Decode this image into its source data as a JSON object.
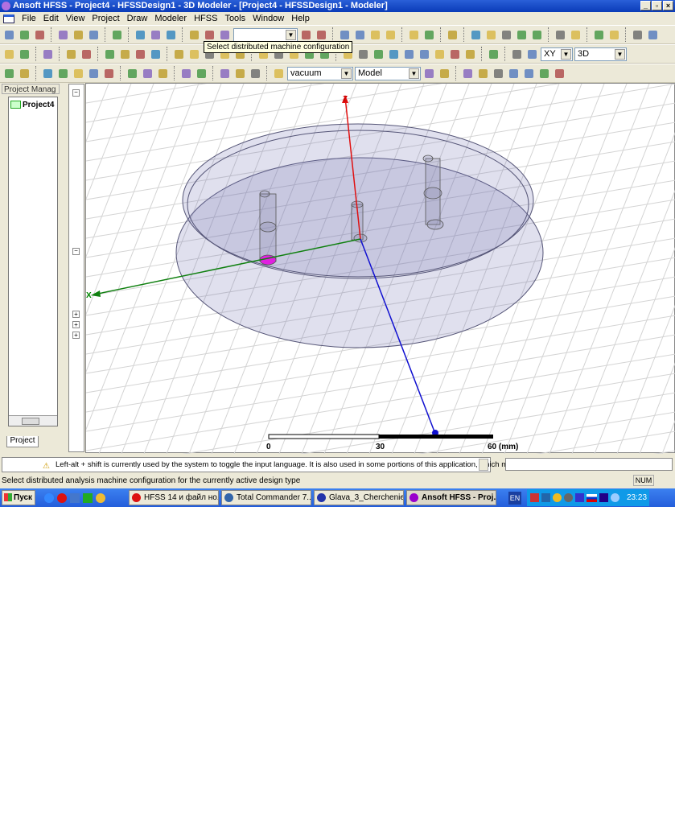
{
  "window": {
    "title": "Ansoft HFSS - Project4 - HFSSDesign1 - 3D Modeler - [Project4 - HFSSDesign1 - Modeler]"
  },
  "menu": [
    "File",
    "Edit",
    "View",
    "Project",
    "Draw",
    "Modeler",
    "HFSS",
    "Tools",
    "Window",
    "Help"
  ],
  "toolbar1": {
    "icons": [
      "new-icon",
      "open-icon",
      "save-icon",
      "|",
      "cut-icon",
      "copy-icon",
      "paste-icon",
      "|",
      "print-icon",
      "|",
      "delete-icon",
      "undo-icon",
      "redo-icon",
      "|",
      "distributed-machine-icon",
      "machine-icon",
      "network-icon"
    ],
    "icons2": [
      "machine-config-icon",
      "quick-icon",
      "|",
      "validate-icon",
      "analyze-icon",
      "results-icon",
      "report-icon",
      "|",
      "zoom-icon",
      "plot-icon",
      "|",
      "layout-icon",
      "|",
      "pan-icon",
      "rotate-icon",
      "rotate-axis-icon",
      "orbit-icon",
      "info-icon",
      "|",
      "zoom-in-icon",
      "zoom-out-icon",
      "|",
      "fit-all-icon",
      "fit-selection-icon",
      "|",
      "undo-view-icon",
      "redo-view-icon"
    ]
  },
  "toolbar2": {
    "icons": [
      "help-icon",
      "context-help-icon",
      "|",
      "show-icon",
      "|",
      "hide-icon",
      "hide-all-icon",
      "|",
      "show-selected-icon",
      "show-all-icon",
      "view-icon",
      "view2-icon",
      "|",
      "line-icon",
      "spline-icon",
      "arc-icon",
      "arc2-icon",
      "equation-icon",
      "|",
      "rectangle-icon",
      "circle-icon",
      "polygon-icon",
      "ellipse-icon",
      "region-icon",
      "|",
      "box-icon",
      "cylinder-icon",
      "regular-polyhedron-icon",
      "cone-icon",
      "sphere-icon",
      "torus-icon",
      "helix-icon",
      "spiral-icon",
      "bondwire-icon",
      "|",
      "region-box-icon",
      "|",
      "point-icon",
      "plane-icon"
    ],
    "plane": "XY",
    "view_mode": "3D"
  },
  "toolbar3": {
    "icons": [
      "unite-icon",
      "subtract-icon",
      "|",
      "split-icon",
      "intersect-icon",
      "imprint-icon",
      "sweep-icon",
      "thicken-icon",
      "|",
      "move-icon",
      "rotate-object-icon",
      "mirror-icon",
      "|",
      "coordinate-icon",
      "face-cs-icon",
      "|",
      "duplicate-along-icon",
      "duplicate-around-icon",
      "duplicate-mirror-icon",
      "|",
      "material-icon"
    ],
    "material": "vacuum",
    "model": "Model",
    "icons2": [
      "measure-icon",
      "measure2-icon",
      "|",
      "snap-icon",
      "snap2-icon",
      "snap3-icon",
      "snap4-icon",
      "grid-icon",
      "grid2-icon",
      "grid3-icon"
    ]
  },
  "tooltip": "Select distributed machine configuration",
  "project_manager": {
    "title": "Project Manag",
    "project": "Project4",
    "tab": "Project"
  },
  "viewport": {
    "z_label": "Z",
    "x_label": "X",
    "scale": {
      "labels": [
        "0",
        "30",
        "60 (mm)"
      ]
    }
  },
  "message": "Left-alt + shift is currently used by the system to toggle the input language. It is also used in some portions of this application, which may",
  "status": {
    "text": "Select distributed analysis machine configuration for the currently active design type",
    "num": "NUM"
  },
  "taskbar": {
    "start": "Пуск",
    "tasks": [
      "HFSS 14 и файл но...",
      "Total Commander 7....",
      "Glava_3_Cherchenie...",
      "Ansoft HFSS - Proj..."
    ],
    "lang": "EN",
    "clock": "23:23"
  },
  "colors": {
    "accent": "#245edb",
    "title": "#0a3bb8"
  }
}
